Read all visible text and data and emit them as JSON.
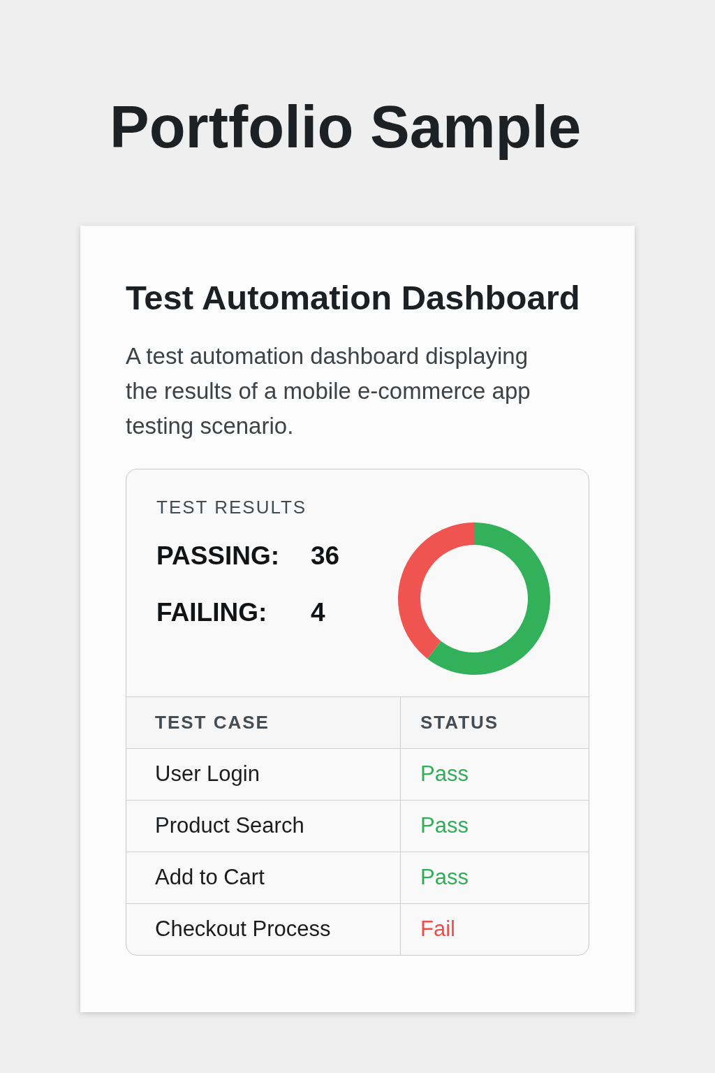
{
  "page": {
    "title": "Portfolio Sample"
  },
  "card": {
    "title": "Test Automation Dashboard",
    "description": "A test automation dashboard displaying the results of a mobile e-commerce app testing scenario."
  },
  "results": {
    "heading": "TEST RESULTS",
    "stats": [
      {
        "label": "PASSING:",
        "value": "36"
      },
      {
        "label": "FAILING:",
        "value": "4"
      }
    ]
  },
  "table": {
    "columns": [
      "TEST CASE",
      "STATUS"
    ],
    "rows": [
      {
        "test_case": "User Login",
        "status": "Pass",
        "color": "#31ad58"
      },
      {
        "test_case": "Product Search",
        "status": "Pass",
        "color": "#31ad58"
      },
      {
        "test_case": "Add to Cart",
        "status": "Pass",
        "color": "#31ad58"
      },
      {
        "test_case": "Checkout Process",
        "status": "Fail",
        "color": "#ee4f4b"
      }
    ]
  }
}
